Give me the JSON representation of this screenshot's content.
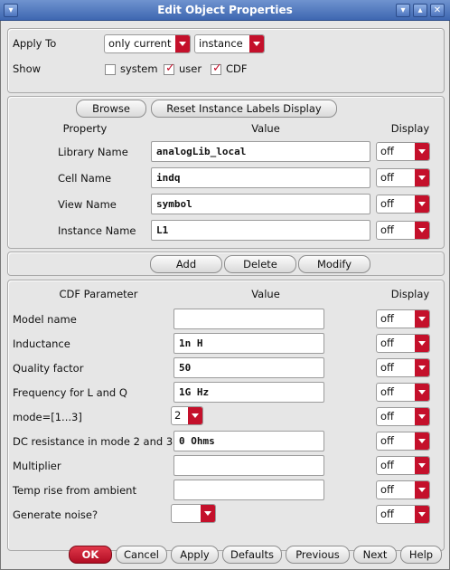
{
  "window": {
    "title": "Edit Object Properties"
  },
  "top": {
    "apply_to_label": "Apply To",
    "apply_scope": "only current",
    "apply_type": "instance",
    "show_label": "Show",
    "checks": [
      {
        "label": "system",
        "checked": false
      },
      {
        "label": "user",
        "checked": true
      },
      {
        "label": "CDF",
        "checked": true
      }
    ]
  },
  "props": {
    "browse_label": "Browse",
    "reset_label": "Reset Instance Labels Display",
    "headers": {
      "property": "Property",
      "value": "Value",
      "display": "Display"
    },
    "rows": [
      {
        "label": "Library Name",
        "value": "analogLib_local",
        "display": "off"
      },
      {
        "label": "Cell Name",
        "value": "indq",
        "display": "off"
      },
      {
        "label": "View Name",
        "value": "symbol",
        "display": "off"
      },
      {
        "label": "Instance Name",
        "value": "L1",
        "display": "off"
      }
    ]
  },
  "actions": {
    "add": "Add",
    "delete": "Delete",
    "modify": "Modify"
  },
  "cdf": {
    "headers": {
      "param": "CDF Parameter",
      "value": "Value",
      "display": "Display"
    },
    "rows": [
      {
        "label": "Model name",
        "value": "",
        "display": "off",
        "kind": "field"
      },
      {
        "label": "Inductance",
        "value": "1n H",
        "display": "off",
        "kind": "field"
      },
      {
        "label": "Quality factor",
        "value": "50",
        "display": "off",
        "kind": "field"
      },
      {
        "label": "Frequency for L and Q",
        "value": "1G Hz",
        "display": "off",
        "kind": "field"
      },
      {
        "label": "mode=[1...3]",
        "value": "2",
        "display": "off",
        "kind": "combo"
      },
      {
        "label": "DC resistance in mode 2 and 3",
        "value": "0 Ohms",
        "display": "off",
        "kind": "field"
      },
      {
        "label": "Multiplier",
        "value": "",
        "display": "off",
        "kind": "field"
      },
      {
        "label": "Temp rise from ambient",
        "value": "",
        "display": "off",
        "kind": "field"
      },
      {
        "label": "Generate noise?",
        "value": "",
        "display": "off",
        "kind": "combo"
      }
    ]
  },
  "footer": {
    "ok": "OK",
    "cancel": "Cancel",
    "apply": "Apply",
    "defaults": "Defaults",
    "previous": "Previous",
    "next": "Next",
    "help": "Help"
  },
  "colors": {
    "accent": "#c4102b",
    "titlebar": "#4a72b8"
  },
  "icons": [
    "menu-icon",
    "minimize-icon",
    "maximize-icon",
    "close-icon",
    "dropdown-arrow-icon",
    "checkmark-icon"
  ]
}
